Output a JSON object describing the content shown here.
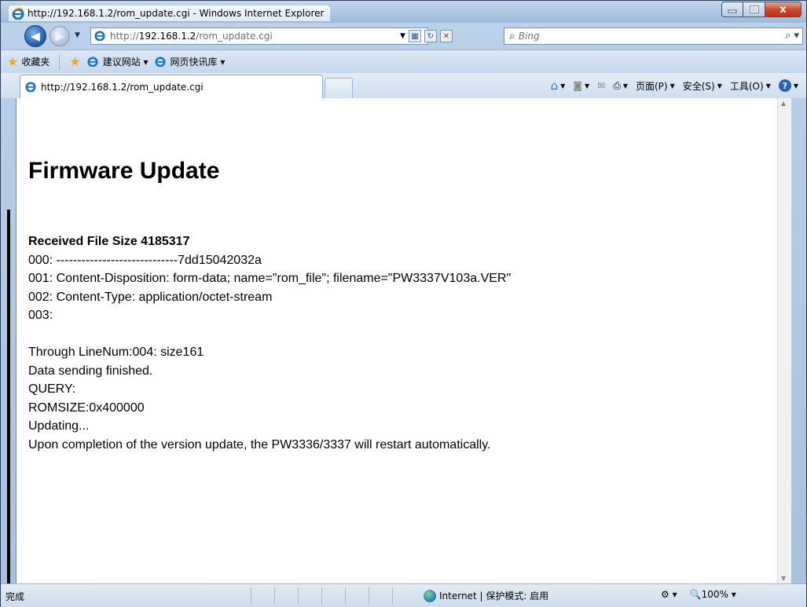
{
  "window": {
    "title": "http://192.168.1.2/rom_update.cgi - Windows Internet Explorer",
    "close": "x"
  },
  "address": {
    "prefix": "http://",
    "host": "192.168.1.2",
    "path": "/rom_update.cgi",
    "search_placeholder": "Bing"
  },
  "favorites": {
    "label": "收藏夹",
    "items": [
      {
        "label": "建议网站 ▾"
      },
      {
        "label": "网页快讯库 ▾"
      }
    ]
  },
  "tab": {
    "title": "http://192.168.1.2/rom_update.cgi"
  },
  "commands": {
    "page": "页面(P)",
    "safety": "安全(S)",
    "tools": "工具(O)"
  },
  "page": {
    "heading": "Firmware Update",
    "received": "Received File Size 4185317",
    "lines": [
      "000: -----------------------------7dd15042032a",
      "001: Content-Disposition: form-data; name=\"rom_file\"; filename=\"PW3337V103a.VER\"",
      "002: Content-Type: application/octet-stream",
      "003:"
    ],
    "after": [
      "Through LineNum:004: size161",
      "Data sending finished.",
      "QUERY:",
      "ROMSIZE:0x400000",
      "Updating...",
      "Upon completion of the version update, the PW3336/3337 will restart automatically."
    ]
  },
  "status": {
    "left": "完成",
    "zone": "Internet | 保护模式: 启用",
    "zoom": "100%"
  }
}
